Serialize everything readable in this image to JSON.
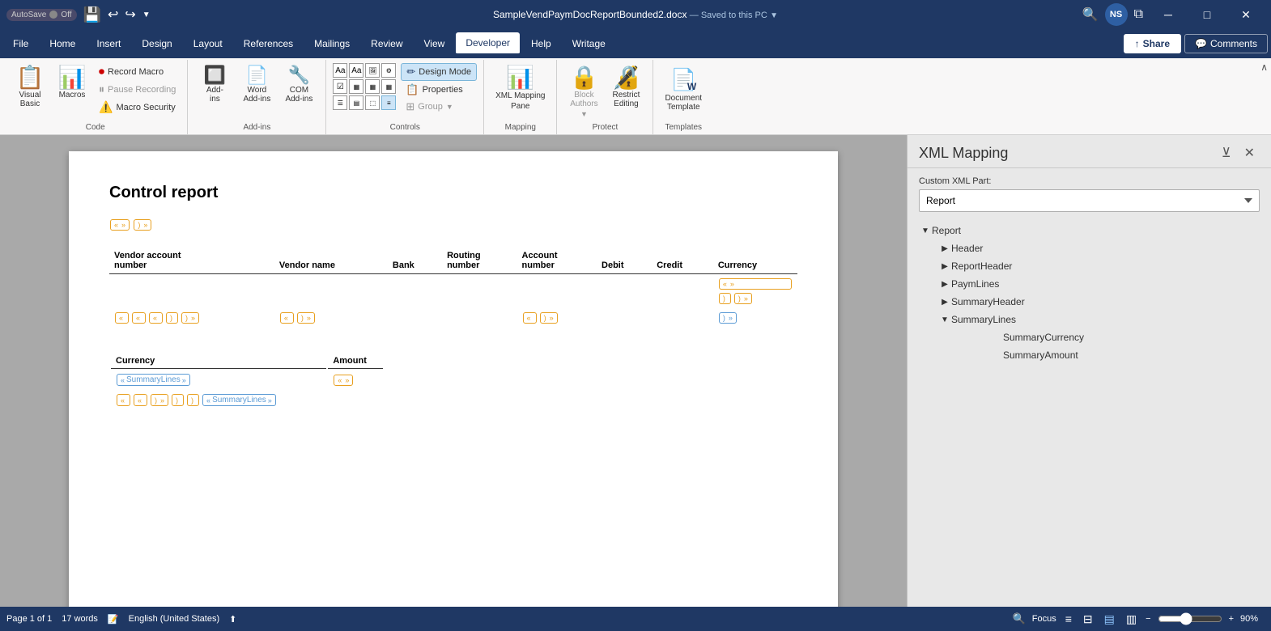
{
  "titlebar": {
    "autosave": "AutoSave",
    "autosave_state": "Off",
    "filename": "SampleVendPaymDocReportBounded2.docx",
    "save_state": "Saved to this PC",
    "user_initials": "NS"
  },
  "menu": {
    "items": [
      "File",
      "Home",
      "Insert",
      "Design",
      "Layout",
      "References",
      "Mailings",
      "Review",
      "View",
      "Developer",
      "Help",
      "Writage"
    ],
    "active": "Developer",
    "share_label": "Share",
    "comments_label": "Comments"
  },
  "ribbon": {
    "groups": {
      "code": {
        "label": "Code",
        "visual_basic": "Visual\nBasic",
        "macros": "Macros",
        "record_macro": "Record Macro",
        "pause_recording": "Pause Recording",
        "macro_security": "Macro Security"
      },
      "add_ins": {
        "label": "Add-ins",
        "add_ins": "Add-\nins",
        "word_add_ins": "Word\nAdd-ins",
        "com_add_ins": "COM\nAdd-ins"
      },
      "controls": {
        "label": "Controls",
        "design_mode": "Design Mode",
        "properties": "Properties",
        "group": "Group"
      },
      "mapping": {
        "label": "Mapping",
        "xml_mapping_pane": "XML Mapping\nPane"
      },
      "protect": {
        "label": "Protect",
        "block_authors": "Block\nAuthors",
        "restrict_editing": "Restrict\nEditing"
      },
      "templates": {
        "label": "Templates",
        "document_template": "Document\nTemplate"
      }
    }
  },
  "document": {
    "title": "Control report",
    "table_headers": [
      "Vendor account\nnumber",
      "Vendor name",
      "Bank",
      "Routing\nnumber",
      "Account\nnumber",
      "Debit",
      "Credit",
      "Currency"
    ],
    "summary_headers": [
      "Currency",
      "Amount"
    ],
    "summary_lines_label": "SummaryLines",
    "summary_lines_label2": "SummaryLines"
  },
  "xml_panel": {
    "title": "XML Mapping",
    "custom_xml_part_label": "Custom XML Part:",
    "selected_part": "Report",
    "tree": {
      "root": "Report",
      "children": [
        {
          "name": "Header",
          "expanded": false,
          "children": []
        },
        {
          "name": "ReportHeader",
          "expanded": false,
          "children": []
        },
        {
          "name": "PaymLines",
          "expanded": false,
          "children": []
        },
        {
          "name": "SummaryHeader",
          "expanded": false,
          "children": []
        },
        {
          "name": "SummaryLines",
          "expanded": true,
          "children": [
            {
              "name": "SummaryCurrency",
              "leaf": true
            },
            {
              "name": "SummaryAmount",
              "leaf": true
            }
          ]
        }
      ]
    }
  },
  "statusbar": {
    "page_info": "Page 1 of 1",
    "word_count": "17 words",
    "language": "English (United States)",
    "focus_label": "Focus",
    "zoom_percent": "90%"
  }
}
